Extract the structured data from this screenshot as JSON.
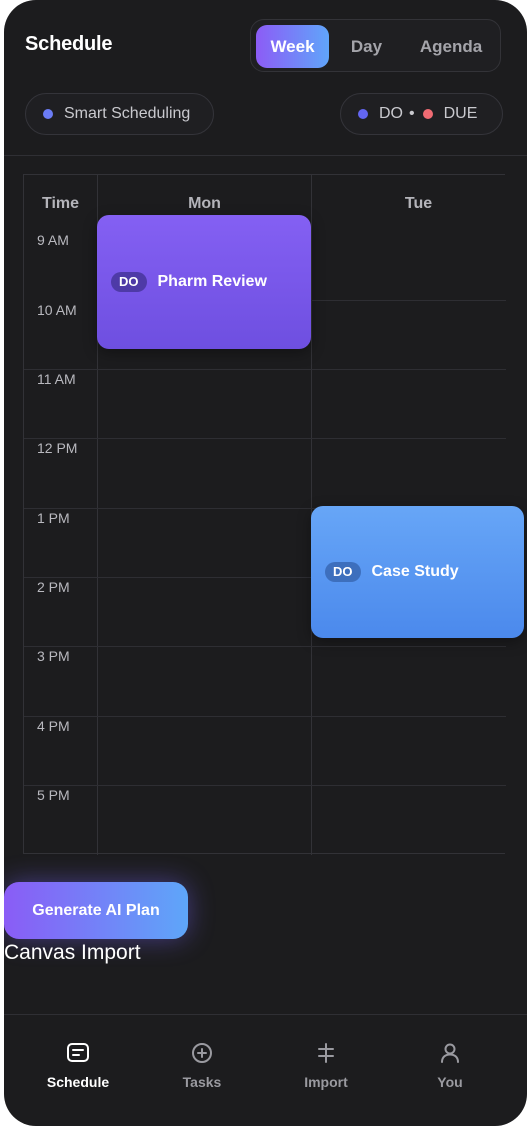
{
  "header": {
    "title": "Schedule",
    "view_tabs": [
      {
        "label": "Week",
        "active": true
      },
      {
        "label": "Day",
        "active": false
      },
      {
        "label": "Agenda",
        "active": false
      }
    ]
  },
  "smart_scheduling": {
    "label": "Smart Scheduling",
    "dot_color": "#6b7cf5"
  },
  "legend": {
    "do_label": "DO",
    "separator": "•",
    "due_label": "DUE",
    "do_color": "#6366f1",
    "due_color": "#f06b73"
  },
  "calendar": {
    "headers": {
      "time": "Time",
      "mon": "Mon",
      "tue": "Tue"
    },
    "times": [
      "9 AM",
      "10 AM",
      "11 AM",
      "12 PM",
      "1 PM",
      "2 PM",
      "3 PM",
      "4 PM",
      "5 PM"
    ],
    "events": [
      {
        "day": "Mon",
        "start": "9 AM",
        "end": "10 AM",
        "badge": "DO",
        "title": "Pharm Review",
        "color": "#7c5cf0"
      },
      {
        "day": "Tue",
        "start": "1 PM",
        "end": "2 PM",
        "badge": "DO",
        "title": "Case Study",
        "color": "#5b9af4"
      }
    ]
  },
  "actions": {
    "generate_label": "Generate AI Plan",
    "canvas_import_label": "Canvas Import"
  },
  "nav": [
    {
      "label": "Schedule",
      "icon": "schedule-icon",
      "active": true
    },
    {
      "label": "Tasks",
      "icon": "plus-circle-icon",
      "active": false
    },
    {
      "label": "Import",
      "icon": "import-icon",
      "active": false
    },
    {
      "label": "You",
      "icon": "user-icon",
      "active": false
    }
  ]
}
